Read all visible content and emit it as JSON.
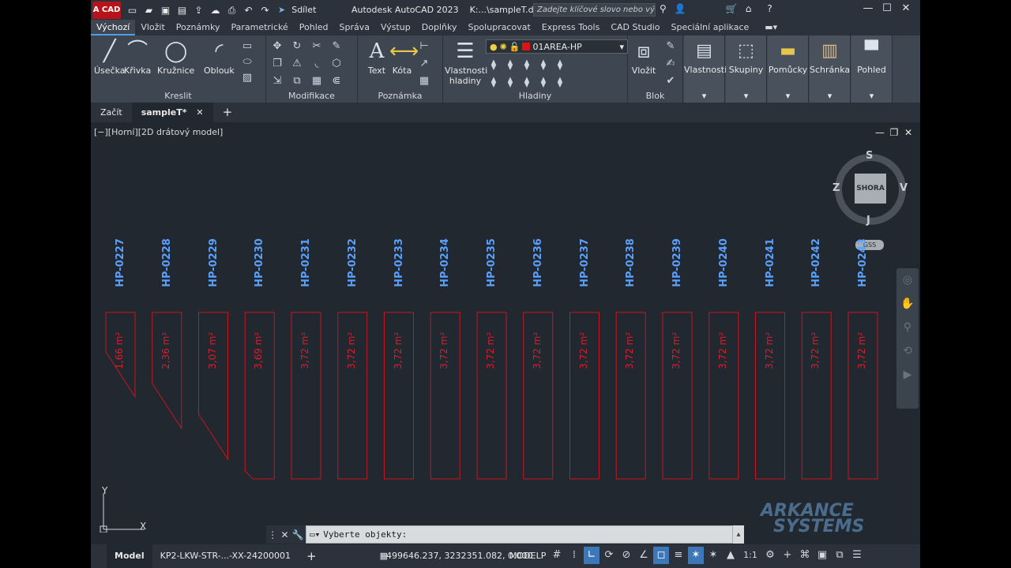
{
  "titlebar": {
    "logo": "A CAD",
    "share": "Sdílet",
    "title": "Autodesk AutoCAD 2023",
    "file": "K:...\\sampleT.dwg",
    "search_placeholder": "Zadejte klíčové slovo nebo výraz."
  },
  "ribbon_tabs": [
    "Výchozí",
    "Vložit",
    "Poznámky",
    "Parametrické",
    "Pohled",
    "Správa",
    "Výstup",
    "Doplňky",
    "Spolupracovat",
    "Express Tools",
    "CAD Studio",
    "Speciální aplikace"
  ],
  "ribbon": {
    "draw": {
      "title": "Kreslit",
      "tools": [
        "Úsečka",
        "Křivka",
        "Kružnice",
        "Oblouk"
      ]
    },
    "modify": {
      "title": "Modifikace"
    },
    "annotation": {
      "title": "Poznámka",
      "tools": [
        "Text",
        "Kóta"
      ]
    },
    "layers": {
      "title": "Hladiny",
      "props_line1": "Vlastnosti",
      "props_line2": "hladiny",
      "current_layer": "01AREA-HP",
      "layer_color": "#e01313"
    },
    "block": {
      "title": "Blok",
      "insert": "Vložit"
    },
    "tiles": [
      "Vlastnosti",
      "Skupiny",
      "Pomůcky",
      "Schránka",
      "Pohled"
    ]
  },
  "file_tabs": {
    "start": "Začít",
    "active": "sampleT*"
  },
  "viewport": {
    "label": "[−][Horní][2D drátový model]",
    "viewcube": {
      "face": "SHORA",
      "n": "S",
      "s": "J",
      "w": "Z",
      "e": "V",
      "wcs": "GSS"
    },
    "ucs_x": "X",
    "ucs_y": "Y",
    "rooms": [
      {
        "id": "HP-0227",
        "area": "1,66 m²"
      },
      {
        "id": "HP-0228",
        "area": "2,36 m²"
      },
      {
        "id": "HP-0229",
        "area": "3,07 m²"
      },
      {
        "id": "HP-0230",
        "area": "3,69 m²"
      },
      {
        "id": "HP-0231",
        "area": "3,72 m²"
      },
      {
        "id": "HP-0232",
        "area": "3,72 m²"
      },
      {
        "id": "HP-0233",
        "area": "3,72 m²"
      },
      {
        "id": "HP-0234",
        "area": "3,72 m²"
      },
      {
        "id": "HP-0235",
        "area": "3,72 m²"
      },
      {
        "id": "HP-0236",
        "area": "3,72 m²"
      },
      {
        "id": "HP-0237",
        "area": "3,72 m²"
      },
      {
        "id": "HP-0238",
        "area": "3,72 m²"
      },
      {
        "id": "HP-0239",
        "area": "3,72 m²"
      },
      {
        "id": "HP-0240",
        "area": "3,72 m²"
      },
      {
        "id": "HP-0241",
        "area": "3,72 m²"
      },
      {
        "id": "HP-0242",
        "area": "3,72 m²"
      },
      {
        "id": "HP-0243",
        "area": "3,72 m²"
      }
    ],
    "watermark_line1": "ARKANCE",
    "watermark_line2": "SYSTEMS"
  },
  "command": {
    "prompt": "Vyberte objekty:"
  },
  "statusbar": {
    "model_tab": "Model",
    "layout_tab": "KP2-LKW-STR-...-XX-24200001",
    "coordinates": "499646.237, 3232351.082, 0.000",
    "mode": "MODELP",
    "scale": "1:1"
  }
}
